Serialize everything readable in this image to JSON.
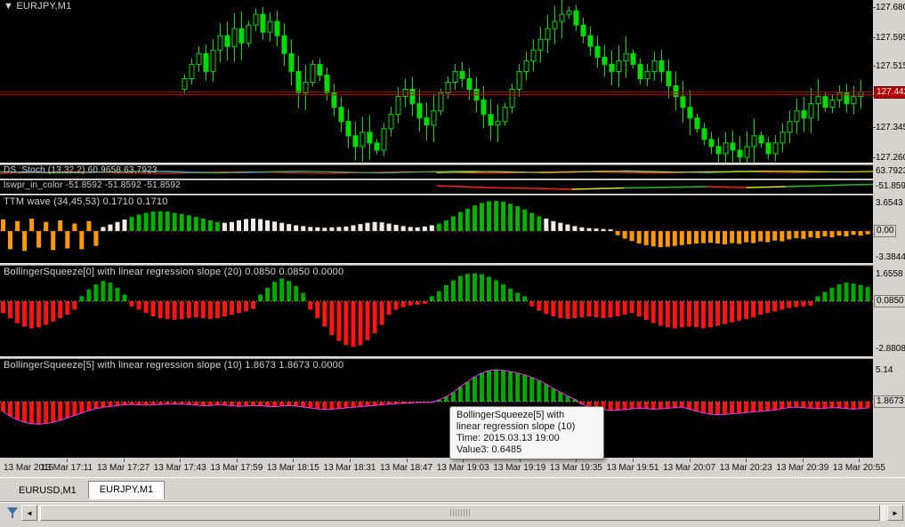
{
  "app": {
    "bg": "#d6d3ce",
    "chart_bg": "#000000"
  },
  "main_chart": {
    "type": "candlestick",
    "marker": "▼",
    "symbol": "EURJPY,M1",
    "price_axis": [
      "127.680",
      "127.595",
      "127.515",
      "127.435",
      "127.345",
      "127.260"
    ],
    "current_price": "127.442",
    "current_price_num": 127.442,
    "price_lines": [
      127.442,
      127.435
    ],
    "candle_color": "#00DC00",
    "closes": [
      127.48,
      127.52,
      127.55,
      127.5,
      127.56,
      127.6,
      127.57,
      127.62,
      127.58,
      127.63,
      127.66,
      127.61,
      127.64,
      127.6,
      127.55,
      127.5,
      127.44,
      127.47,
      127.52,
      127.49,
      127.44,
      127.4,
      127.36,
      127.32,
      127.29,
      127.33,
      127.3,
      127.28,
      127.34,
      127.38,
      127.43,
      127.45,
      127.41,
      127.37,
      127.35,
      127.39,
      127.44,
      127.47,
      127.5,
      127.48,
      127.45,
      127.42,
      127.38,
      127.35,
      127.36,
      127.4,
      127.45,
      127.5,
      127.53,
      127.56,
      127.59,
      127.62,
      127.64,
      127.66,
      127.67,
      127.63,
      127.6,
      127.57,
      127.54,
      127.52,
      127.5,
      127.53,
      127.55,
      127.52,
      127.48,
      127.5,
      127.53,
      127.5,
      127.46,
      127.43,
      127.4,
      127.37,
      127.34,
      127.31,
      127.29,
      127.27,
      127.3,
      127.28,
      127.26,
      127.29,
      127.32,
      127.3,
      127.27,
      127.3,
      127.33,
      127.36,
      127.39,
      127.37,
      127.41,
      127.43,
      127.4,
      127.42,
      127.44,
      127.41,
      127.43,
      127.442
    ]
  },
  "stoch_panel": {
    "type": "line",
    "label": "DS :Stoch (13,32,2) 60.9658 63.7923",
    "axis_value": "63.7923",
    "lines": [
      {
        "color": "#4a4aff",
        "x0": 0,
        "values": [
          55,
          62,
          58,
          50,
          55,
          63,
          66,
          60,
          54,
          50,
          56,
          62,
          58,
          52,
          48,
          54,
          60,
          64,
          58,
          52,
          56,
          62,
          66,
          60,
          55,
          58,
          63,
          60,
          55,
          52,
          56,
          60,
          62
        ]
      },
      {
        "color": "#ff3636",
        "x0": 0,
        "values": [
          45,
          50,
          56,
          60,
          54,
          48,
          44,
          50,
          56,
          60,
          55,
          49,
          45,
          50,
          56,
          61,
          57,
          51,
          47,
          52,
          58,
          62,
          57,
          52,
          48,
          53,
          58,
          62,
          58,
          53,
          57,
          61,
          64
        ]
      },
      {
        "color": "#2fc62f",
        "x0": 0,
        "values": [
          60,
          54,
          48,
          53,
          59,
          64,
          59,
          53,
          49,
          55,
          61,
          65,
          60,
          54,
          50,
          56,
          62,
          66,
          61,
          55,
          51,
          57,
          63,
          67,
          62,
          56,
          52,
          58,
          64,
          67,
          62,
          58,
          60
        ]
      },
      {
        "color": "#d2d200",
        "x0": 0.5,
        "values": [
          50,
          56,
          62,
          58,
          52,
          56,
          62,
          66,
          60,
          55,
          58,
          63,
          66,
          64,
          60,
          58,
          62
        ]
      }
    ]
  },
  "lswpr_panel": {
    "type": "line",
    "label": "lswpr_in_color -51.8592 -51.8592 -51.8592",
    "axis_value": "-51.8592",
    "segments": [
      {
        "color": "#ff2020",
        "pts": [
          [
            0.5,
            6
          ],
          [
            0.53,
            7
          ],
          [
            0.555,
            8
          ],
          [
            0.58,
            8.5
          ],
          [
            0.61,
            9
          ],
          [
            0.635,
            9.5
          ],
          [
            0.655,
            10
          ]
        ]
      },
      {
        "color": "#e2e200",
        "pts": [
          [
            0.655,
            10
          ],
          [
            0.675,
            9.5
          ],
          [
            0.695,
            9
          ],
          [
            0.715,
            8.5
          ]
        ]
      },
      {
        "color": "#22bb22",
        "pts": [
          [
            0.715,
            8.5
          ],
          [
            0.75,
            8
          ],
          [
            0.78,
            7.5
          ],
          [
            0.81,
            7
          ]
        ]
      },
      {
        "color": "#ff2020",
        "pts": [
          [
            0.81,
            7
          ],
          [
            0.835,
            7.5
          ],
          [
            0.855,
            8
          ]
        ]
      },
      {
        "color": "#e2e200",
        "pts": [
          [
            0.855,
            8
          ],
          [
            0.88,
            7.5
          ],
          [
            0.9,
            7
          ]
        ]
      },
      {
        "color": "#22bb22",
        "pts": [
          [
            0.9,
            7
          ],
          [
            0.94,
            6
          ],
          [
            0.97,
            5
          ],
          [
            1.0,
            4.5
          ]
        ]
      }
    ]
  },
  "ttm_panel": {
    "type": "bar",
    "label": "TTM wave (34,45,53) 0.1710 0.1710",
    "axis_top": "3.6543",
    "axis_zero": "0.00",
    "axis_bottom": "-3.3844",
    "bar_colors": {
      "o": "#FF9900",
      "g": "#00B400",
      "w": "#EDEDED"
    },
    "colors": "oooooooooooooowwwwgggggggggggggwwwwwwwwwwwwwwwwwwwwwwwwwwwwwwgggggggggggggggwwwwwwwwwwoooooooooooooooooooooooooooooooooooo",
    "values": [
      1.4,
      -2.2,
      1.2,
      -2.4,
      1.5,
      -2.0,
      1.1,
      -2.3,
      1.3,
      -2.1,
      0.9,
      -2.2,
      1.2,
      -1.8,
      0.5,
      0.8,
      1.1,
      1.4,
      1.7,
      2.0,
      2.2,
      2.35,
      2.4,
      2.35,
      2.2,
      2.05,
      1.9,
      1.7,
      1.5,
      1.3,
      1.1,
      1.0,
      1.1,
      1.3,
      1.45,
      1.5,
      1.45,
      1.3,
      1.15,
      1.0,
      0.85,
      0.7,
      0.6,
      0.5,
      0.45,
      0.4,
      0.45,
      0.5,
      0.55,
      0.7,
      0.85,
      1.0,
      1.1,
      1.05,
      0.9,
      0.75,
      0.6,
      0.5,
      0.45,
      0.55,
      0.7,
      0.9,
      1.3,
      1.8,
      2.3,
      2.7,
      3.1,
      3.4,
      3.6,
      3.65,
      3.55,
      3.3,
      3.0,
      2.6,
      2.2,
      1.8,
      1.5,
      1.2,
      1.0,
      0.8,
      0.6,
      0.45,
      0.35,
      0.3,
      0.25,
      0.2,
      -0.5,
      -0.9,
      -1.2,
      -1.5,
      -1.7,
      -1.85,
      -1.95,
      -1.9,
      -1.8,
      -1.7,
      -1.6,
      -1.5,
      -1.45,
      -1.4,
      -1.5,
      -1.6,
      -1.45,
      -1.55,
      -1.35,
      -1.45,
      -1.25,
      -1.35,
      -1.15,
      -1.25,
      -1.0,
      -0.85,
      -0.95,
      -0.75,
      -0.85,
      -0.65,
      -0.75,
      -0.55,
      -0.65,
      -0.45,
      -0.55,
      -0.4
    ]
  },
  "bs0_panel": {
    "type": "bar",
    "label": "BollingerSqueeze[0] with linear regression slope (20) 0.0850 0.0850 0.0000",
    "axis_top": "1.6558",
    "axis_bottom": "-2.8808",
    "current": "0.0850",
    "up_color": "#00A800",
    "down_color": "#FF1414",
    "values": [
      -0.7,
      -1.0,
      -1.3,
      -1.5,
      -1.6,
      -1.55,
      -1.4,
      -1.2,
      -1.0,
      -0.8,
      -0.5,
      0.3,
      0.7,
      1.0,
      1.2,
      1.1,
      0.8,
      0.4,
      -0.3,
      -0.5,
      -0.7,
      -0.9,
      -1.0,
      -1.05,
      -1.1,
      -1.05,
      -1.0,
      -0.95,
      -1.0,
      -1.05,
      -1.0,
      -0.9,
      -0.8,
      -0.7,
      -0.6,
      -0.45,
      0.4,
      0.8,
      1.15,
      1.35,
      1.2,
      0.9,
      0.5,
      -0.5,
      -1.0,
      -1.5,
      -2.0,
      -2.35,
      -2.6,
      -2.7,
      -2.6,
      -2.3,
      -1.9,
      -1.4,
      -0.8,
      -0.5,
      -0.35,
      -0.25,
      -0.2,
      -0.15,
      0.3,
      0.6,
      0.95,
      1.25,
      1.5,
      1.62,
      1.65,
      1.6,
      1.45,
      1.25,
      1.0,
      0.75,
      0.5,
      0.3,
      -0.3,
      -0.55,
      -0.75,
      -0.9,
      -1.0,
      -1.05,
      -1.0,
      -0.95,
      -0.9,
      -0.95,
      -1.0,
      -0.95,
      -0.9,
      -0.8,
      -0.7,
      -0.9,
      -1.1,
      -1.3,
      -1.45,
      -1.55,
      -1.6,
      -1.55,
      -1.5,
      -1.55,
      -1.6,
      -1.55,
      -1.45,
      -1.35,
      -1.25,
      -1.15,
      -1.05,
      -0.95,
      -0.8,
      -0.7,
      -0.6,
      -0.5,
      -0.4,
      -0.35,
      -0.3,
      -0.25,
      0.3,
      0.55,
      0.8,
      1.0,
      1.1,
      1.05,
      0.95,
      0.85
    ]
  },
  "bs5_panel": {
    "type": "bar",
    "label": "BollingerSqueeze[5] with linear regression slope (10) 1.8673 1.8673 0.0000",
    "axis_top": "5.14",
    "current": "1.8673",
    "up_color": "#00A800",
    "down_color": "#FF1414",
    "line_color": "#FF30FF",
    "values": [
      -1.6,
      -2.3,
      -2.9,
      -3.3,
      -3.55,
      -3.6,
      -3.5,
      -3.3,
      -3.0,
      -2.6,
      -2.2,
      -1.8,
      -1.4,
      -1.1,
      -0.9,
      -0.75,
      -0.6,
      -0.5,
      -0.45,
      -0.5,
      -0.55,
      -0.5,
      -0.45,
      -0.4,
      -0.35,
      -0.4,
      -0.45,
      -0.55,
      -0.65,
      -0.6,
      -0.5,
      -0.55,
      -0.65,
      -0.75,
      -0.7,
      -0.6,
      -0.65,
      -0.75,
      -0.8,
      -0.7,
      -0.6,
      -0.7,
      -0.85,
      -1.0,
      -1.15,
      -1.25,
      -1.2,
      -1.1,
      -1.0,
      -0.9,
      -0.8,
      -0.7,
      -0.6,
      -0.5,
      -0.4,
      -0.3,
      -0.25,
      -0.2,
      -0.15,
      -0.1,
      -0.1,
      0.3,
      0.8,
      1.5,
      2.4,
      3.2,
      4.0,
      4.6,
      5.0,
      5.14,
      5.05,
      4.85,
      4.6,
      4.3,
      3.9,
      3.4,
      2.8,
      2.1,
      1.5,
      0.9,
      0.4,
      -0.4,
      -0.8,
      -1.1,
      -1.3,
      -1.4,
      -1.35,
      -1.25,
      -1.15,
      -1.05,
      -1.1,
      -1.2,
      -1.15,
      -1.05,
      -0.95,
      -0.85,
      -1.2,
      -1.5,
      -1.8,
      -2.0,
      -2.1,
      -2.05,
      -1.95,
      -1.85,
      -1.75,
      -1.65,
      -1.55,
      -1.45,
      -1.35,
      -1.1,
      -0.95,
      -0.85,
      -0.95,
      -1.05,
      -1.15,
      -1.05,
      -0.95,
      -1.0,
      -1.1,
      -1.2,
      -1.1,
      -1.0
    ]
  },
  "tooltip": {
    "line1": "BollingerSqueeze[5] with",
    "line2": "linear regression slope (10)",
    "line3": "Time: 2015.03.13 19:00",
    "line4": "Value3: 0.6485"
  },
  "time_axis": {
    "labels": [
      "13 Mar 2015",
      "13 Mar 17:11",
      "13 Mar 17:27",
      "13 Mar 17:43",
      "13 Mar 17:59",
      "13 Mar 18:15",
      "13 Mar 18:31",
      "13 Mar 18:47",
      "13 Mar 19:03",
      "13 Mar 19:19",
      "13 Mar 19:35",
      "13 Mar 19:51",
      "13 Mar 20:07",
      "13 Mar 20:23",
      "13 Mar 20:39",
      "13 Mar 20:55"
    ]
  },
  "tabs": [
    {
      "label": "EURUSD,M1",
      "active": false
    },
    {
      "label": "EURJPY,M1",
      "active": true
    }
  ],
  "scrollbar": {
    "left_arrow": "◄",
    "right_arrow": "►"
  }
}
